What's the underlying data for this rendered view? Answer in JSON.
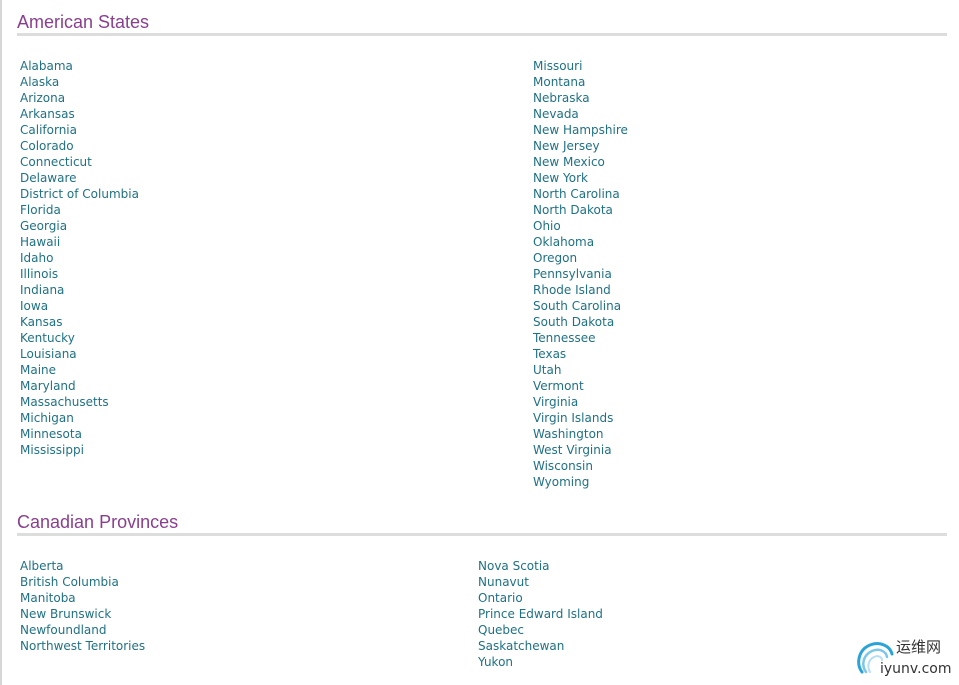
{
  "sections": {
    "states": {
      "title": "American States",
      "column1": [
        "Alabama",
        "Alaska",
        "Arizona",
        "Arkansas",
        "California",
        "Colorado",
        "Connecticut",
        "Delaware",
        "District of Columbia",
        "Florida",
        "Georgia",
        "Hawaii",
        "Idaho",
        "Illinois",
        "Indiana",
        "Iowa",
        "Kansas",
        "Kentucky",
        "Louisiana",
        "Maine",
        "Maryland",
        "Massachusetts",
        "Michigan",
        "Minnesota",
        "Mississippi"
      ],
      "column2": [
        "Missouri",
        "Montana",
        "Nebraska",
        "Nevada",
        "New Hampshire",
        "New Jersey",
        "New Mexico",
        "New York",
        "North Carolina",
        "North Dakota",
        "Ohio",
        "Oklahoma",
        "Oregon",
        "Pennsylvania",
        "Rhode Island",
        "South Carolina",
        "South Dakota",
        "Tennessee",
        "Texas",
        "Utah",
        "Vermont",
        "Virginia",
        "Virgin Islands",
        "Washington",
        "West Virginia",
        "Wisconsin",
        "Wyoming"
      ]
    },
    "provinces": {
      "title": "Canadian Provinces",
      "column1": [
        "Alberta",
        "British Columbia",
        "Manitoba",
        "New Brunswick",
        "Newfoundland",
        "Northwest Territories"
      ],
      "column2": [
        "Nova Scotia",
        "Nunavut",
        "Ontario",
        "Prince Edward Island",
        "Quebec",
        "Saskatchewan",
        "Yukon"
      ]
    }
  },
  "watermark": {
    "chinese_text": "运维网",
    "site_text": "iyunv.com",
    "icon": "swirl-logo-icon"
  },
  "colors": {
    "link": "#1f7184",
    "heading": "#8a3f8e",
    "rule": "#dddddd"
  }
}
